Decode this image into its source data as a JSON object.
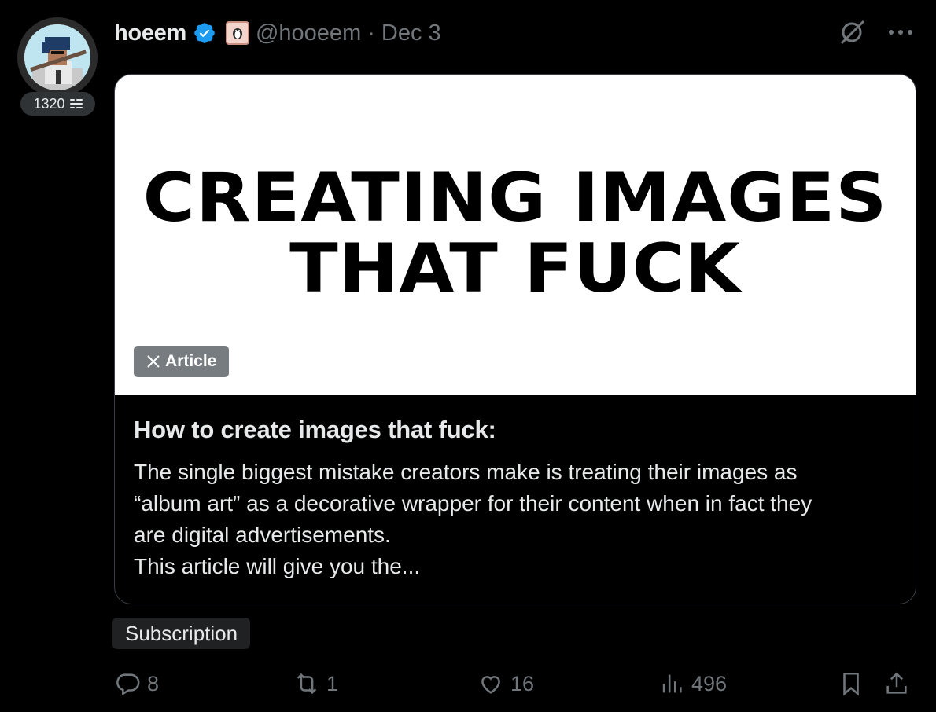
{
  "score": {
    "value": "1320",
    "icon": "list-icon"
  },
  "author": {
    "display_name": "hoeem",
    "handle": "@hooeem",
    "separator": "·",
    "date": "Dec 3",
    "verified_color": "#1d9bf0"
  },
  "card": {
    "headline_line1": "CREATING IMAGES",
    "headline_line2": "THAT FUCK",
    "tag_label": "Article",
    "title": "How to create images that fuck:",
    "description": "The single biggest mistake creators make is treating their images as\n“album art” as a decorative wrapper for their content when in fact they\nare digital advertisements.\nThis article will give you the..."
  },
  "chip": {
    "label": "Subscription"
  },
  "actions": {
    "replies": "8",
    "reposts": "1",
    "likes": "16",
    "views": "496"
  }
}
